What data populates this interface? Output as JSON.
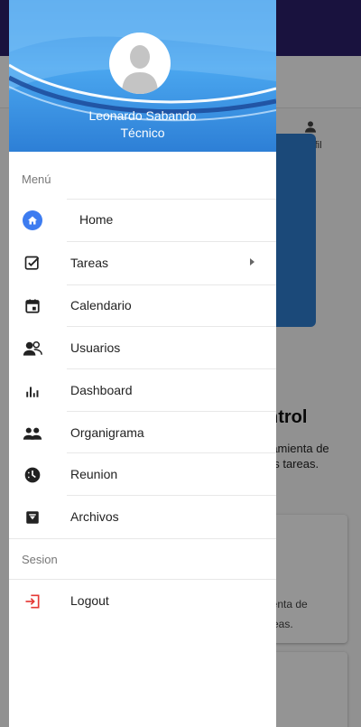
{
  "background": {
    "perfil_label": "Perfil",
    "title_partial": "ntrol",
    "desc_line1": "ramienta de",
    "desc_line2": "us tareas.",
    "card_line1": "ienta de",
    "card_line2": "reas."
  },
  "drawer": {
    "user": {
      "name": "Leonardo Sabando",
      "role": "Técnico"
    },
    "menu_section": "Menú",
    "items": [
      {
        "label": "Home",
        "icon": "home-icon"
      },
      {
        "label": "Tareas",
        "icon": "checkbox-icon",
        "has_submenu": true
      },
      {
        "label": "Calendario",
        "icon": "calendar-icon"
      },
      {
        "label": "Usuarios",
        "icon": "users-icon"
      },
      {
        "label": "Dashboard",
        "icon": "bar-chart-icon"
      },
      {
        "label": "Organigrama",
        "icon": "group-icon"
      },
      {
        "label": "Reunion",
        "icon": "clock-icon"
      },
      {
        "label": "Archivos",
        "icon": "archive-icon"
      }
    ],
    "session_section": "Sesion",
    "logout": {
      "label": "Logout",
      "icon": "logout-icon"
    }
  },
  "colors": {
    "header_blue": "#2b88e0",
    "home_badge": "#3d7cf0",
    "logout_red": "#e53935"
  }
}
